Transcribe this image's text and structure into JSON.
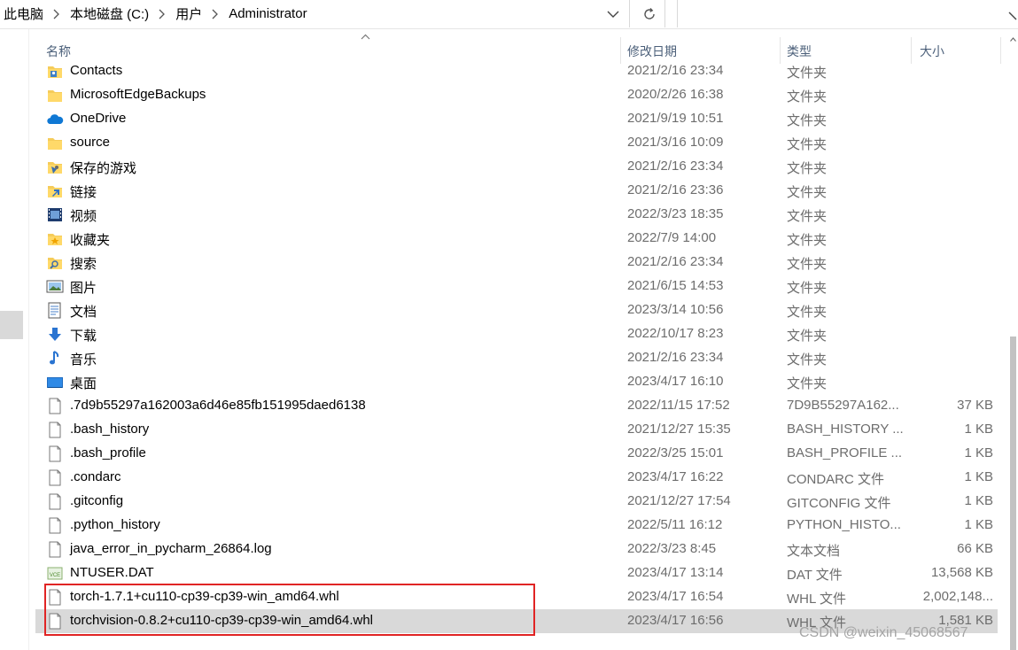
{
  "address": {
    "breadcrumbs": [
      "此电脑",
      "本地磁盘 (C:)",
      "用户",
      "Administrator"
    ]
  },
  "search": {
    "placeholder": ""
  },
  "columns": {
    "name": "名称",
    "date": "修改日期",
    "type": "类型",
    "size": "大小"
  },
  "files": [
    {
      "icon": "contacts-folder-icon",
      "name": "Contacts",
      "date": "2021/2/16 23:34",
      "type": "文件夹",
      "size": ""
    },
    {
      "icon": "folder-icon",
      "name": "MicrosoftEdgeBackups",
      "date": "2020/2/26 16:38",
      "type": "文件夹",
      "size": ""
    },
    {
      "icon": "onedrive-icon",
      "name": "OneDrive",
      "date": "2021/9/19 10:51",
      "type": "文件夹",
      "size": ""
    },
    {
      "icon": "folder-icon",
      "name": "source",
      "date": "2021/3/16 10:09",
      "type": "文件夹",
      "size": ""
    },
    {
      "icon": "saved-games-icon",
      "name": "保存的游戏",
      "date": "2021/2/16 23:34",
      "type": "文件夹",
      "size": ""
    },
    {
      "icon": "links-folder-icon",
      "name": "链接",
      "date": "2021/2/16 23:36",
      "type": "文件夹",
      "size": ""
    },
    {
      "icon": "videos-folder-icon",
      "name": "视频",
      "date": "2022/3/23 18:35",
      "type": "文件夹",
      "size": ""
    },
    {
      "icon": "favorites-folder-icon",
      "name": "收藏夹",
      "date": "2022/7/9 14:00",
      "type": "文件夹",
      "size": ""
    },
    {
      "icon": "searches-folder-icon",
      "name": "搜索",
      "date": "2021/2/16 23:34",
      "type": "文件夹",
      "size": ""
    },
    {
      "icon": "pictures-folder-icon",
      "name": "图片",
      "date": "2021/6/15 14:53",
      "type": "文件夹",
      "size": ""
    },
    {
      "icon": "documents-folder-icon",
      "name": "文档",
      "date": "2023/3/14 10:56",
      "type": "文件夹",
      "size": ""
    },
    {
      "icon": "downloads-folder-icon",
      "name": "下载",
      "date": "2022/10/17 8:23",
      "type": "文件夹",
      "size": ""
    },
    {
      "icon": "music-folder-icon",
      "name": "音乐",
      "date": "2021/2/16 23:34",
      "type": "文件夹",
      "size": ""
    },
    {
      "icon": "desktop-folder-icon",
      "name": "桌面",
      "date": "2023/4/17 16:10",
      "type": "文件夹",
      "size": ""
    },
    {
      "icon": "file-icon",
      "name": ".7d9b55297a162003a6d46e85fb151995daed6138",
      "date": "2022/11/15 17:52",
      "type": "7D9B55297A162...",
      "size": "37 KB"
    },
    {
      "icon": "file-icon",
      "name": ".bash_history",
      "date": "2021/12/27 15:35",
      "type": "BASH_HISTORY ...",
      "size": "1 KB"
    },
    {
      "icon": "file-icon",
      "name": ".bash_profile",
      "date": "2022/3/25 15:01",
      "type": "BASH_PROFILE ...",
      "size": "1 KB"
    },
    {
      "icon": "file-icon",
      "name": ".condarc",
      "date": "2023/4/17 16:22",
      "type": "CONDARC 文件",
      "size": "1 KB"
    },
    {
      "icon": "file-icon",
      "name": ".gitconfig",
      "date": "2021/12/27 17:54",
      "type": "GITCONFIG 文件",
      "size": "1 KB"
    },
    {
      "icon": "file-icon",
      "name": ".python_history",
      "date": "2022/5/11 16:12",
      "type": "PYTHON_HISTO...",
      "size": "1 KB"
    },
    {
      "icon": "file-icon",
      "name": "java_error_in_pycharm_26864.log",
      "date": "2022/3/23 8:45",
      "type": "文本文档",
      "size": "66 KB"
    },
    {
      "icon": "dat-file-icon",
      "name": "NTUSER.DAT",
      "date": "2023/4/17 13:14",
      "type": "DAT 文件",
      "size": "13,568 KB"
    },
    {
      "icon": "file-icon",
      "name": "torch-1.7.1+cu110-cp39-cp39-win_amd64.whl",
      "date": "2023/4/17 16:54",
      "type": "WHL 文件",
      "size": "2,002,148..."
    },
    {
      "icon": "file-icon",
      "name": "torchvision-0.8.2+cu110-cp39-cp39-win_amd64.whl",
      "date": "2023/4/17 16:56",
      "type": "WHL 文件",
      "size": "1,581 KB",
      "selected": true
    }
  ],
  "watermark": "CSDN @weixin_45068567",
  "colors": {
    "highlight": "#e02424",
    "selected_row": "#d9d9d9",
    "header_text": "#4c607a"
  }
}
